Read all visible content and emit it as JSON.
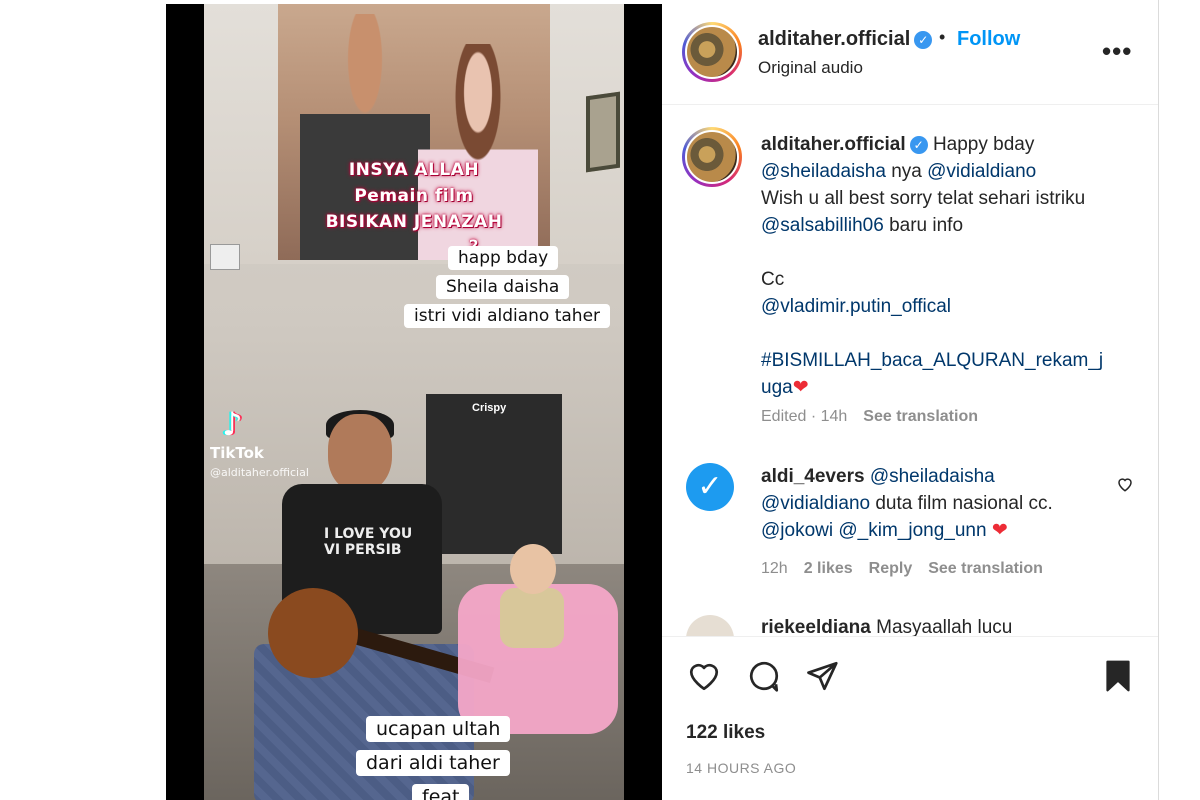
{
  "post": {
    "username": "alditaher.official",
    "follow_label": "Follow",
    "audio_label": "Original audio",
    "more_label": "•••"
  },
  "video": {
    "poster_lines": [
      "INSYA ALLAH",
      "Pemain film",
      "BISIKAN JENAZAH",
      "2"
    ],
    "captions_top": [
      "happ bday",
      "Sheila daisha",
      "istri vidi aldiano taher"
    ],
    "captions_bottom": [
      "ucapan ultah",
      "dari aldi taher",
      "feat"
    ],
    "tiktok_brand": "TikTok",
    "tiktok_handle": "@alditaher.official",
    "shirt_text": "I LOVE YOU\nVI PERSIB",
    "banner_text": "Crispy"
  },
  "caption": {
    "username": "alditaher.official",
    "text_1": "Happy bday",
    "mention_1": "@sheiladaisha",
    "text_2": "nya",
    "mention_2": "@vidialdiano",
    "line_2": "Wish u all best sorry telat sehari istriku",
    "mention_3": "@salsabillih06",
    "text_3": "baru info",
    "cc_label": "Cc",
    "mention_4": "@vladimir.putin_offical",
    "hashtag": "#BISMILLAH_baca_ALQURAN_rekam_j",
    "hashtag_end": "uga",
    "heart": "❤",
    "edited": "Edited · 14h",
    "see_translation": "See translation"
  },
  "comments": [
    {
      "username": "aldi_4evers",
      "mention_1": "@sheiladaisha",
      "mention_2": "@vidialdiano",
      "text_1": "duta film nasional cc.",
      "mention_3": "@jokowi",
      "mention_4": "@_kim_jong_unn",
      "heart": "❤",
      "time": "12h",
      "likes": "2 likes",
      "reply": "Reply",
      "see_translation": "See translation"
    },
    {
      "username": "riekeeldiana",
      "text": "Masyaallah lucu"
    }
  ],
  "footer": {
    "likes": "122 likes",
    "time": "14 HOURS AGO"
  },
  "colors": {
    "link": "#00376b",
    "follow": "#0095f6",
    "meta": "#8e8e8e",
    "heart_red": "#ed2c36"
  },
  "icons": [
    "heart-icon",
    "comment-icon",
    "share-icon",
    "bookmark-icon",
    "verified-icon",
    "more-icon"
  ]
}
